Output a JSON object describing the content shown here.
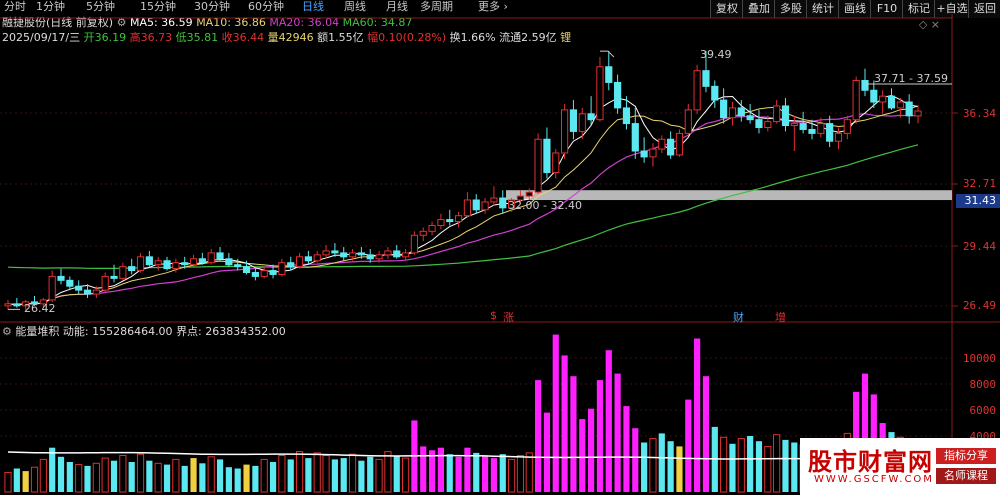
{
  "periods": [
    "分时",
    "1分钟",
    "5分钟",
    "15分钟",
    "30分钟",
    "60分钟",
    "日线",
    "周线",
    "月线",
    "多周期",
    "更多 ›"
  ],
  "active_period": "日线",
  "toolbar": [
    "复权",
    "叠加",
    "多股",
    "统计",
    "画线",
    "F10",
    "标记",
    "+自选",
    "返回"
  ],
  "title_line": {
    "stock": "融捷股份(日线 前复权)",
    "ma5": "MA5: 36.59",
    "ma10": "MA10: 36.86",
    "ma20": "MA20: 36.04",
    "ma60": "MA60: 34.87"
  },
  "quote_line": {
    "date": "2025/09/17/三",
    "open": "开36.19",
    "high": "高36.73",
    "low": "低35.81",
    "close": "收36.44",
    "volume": "量42946",
    "amount": "额1.55亿",
    "change": "幅0.10(0.28%)",
    "turnover": "换1.66%",
    "float": "流通2.59亿",
    "lock": "锂"
  },
  "price_axis": [
    "36.34",
    "32.71",
    "29.44",
    "26.49"
  ],
  "current_price_tag": "31.43",
  "annotations": {
    "high_mark": "39.49",
    "low_mark": "26.42",
    "zone_label": "32.00 - 32.40",
    "range_label": "37.71 - 37.59"
  },
  "events": [
    {
      "text": "$",
      "color": "#e03030"
    },
    {
      "text": "涨",
      "color": "#e03030"
    },
    {
      "text": "财",
      "color": "#4aa3ff"
    },
    {
      "text": "增",
      "color": "#e03030"
    }
  ],
  "indicator": {
    "title": "能量堆积",
    "momentum": "动能: 155286464.00",
    "boundary": "界点: 263834352.00"
  },
  "volume_axis": [
    "10000",
    "8000",
    "6000",
    "4000"
  ],
  "watermark": {
    "title": "股市财富网",
    "url": "WWW.GSCFW.COM",
    "badge1": "指标分享",
    "badge2": "名师课程"
  },
  "colors": {
    "up": "#e03030",
    "down": "#5ce8f0",
    "ma5": "#ffffff",
    "ma10": "#e8d470",
    "ma20": "#d040d0",
    "ma60": "#40c040",
    "vol_mag": "#ff20ff",
    "vol_cyan": "#5ce8f0",
    "vol_yellow": "#f0d040",
    "zone": "#b8b8b8"
  },
  "candles": [
    [
      26.5,
      26.8,
      26.3,
      26.6
    ],
    [
      26.6,
      26.9,
      26.4,
      26.5
    ],
    [
      26.5,
      26.8,
      26.3,
      26.7
    ],
    [
      26.7,
      27.0,
      26.5,
      26.6
    ],
    [
      26.6,
      26.9,
      26.4,
      26.8
    ],
    [
      26.8,
      28.3,
      26.7,
      28.0
    ],
    [
      28.0,
      28.4,
      27.6,
      27.8
    ],
    [
      27.8,
      28.0,
      27.3,
      27.5
    ],
    [
      27.5,
      27.8,
      27.1,
      27.3
    ],
    [
      27.3,
      27.6,
      26.9,
      27.1
    ],
    [
      27.1,
      27.5,
      26.9,
      27.3
    ],
    [
      27.3,
      28.2,
      27.2,
      28.0
    ],
    [
      28.0,
      28.6,
      27.7,
      27.9
    ],
    [
      27.9,
      28.7,
      27.8,
      28.5
    ],
    [
      28.5,
      28.9,
      28.1,
      28.3
    ],
    [
      28.3,
      29.2,
      28.2,
      29.0
    ],
    [
      29.0,
      29.3,
      28.5,
      28.6
    ],
    [
      28.6,
      29.0,
      28.3,
      28.8
    ],
    [
      28.8,
      29.0,
      28.3,
      28.4
    ],
    [
      28.4,
      28.9,
      28.2,
      28.7
    ],
    [
      28.7,
      29.0,
      28.4,
      28.6
    ],
    [
      28.6,
      29.1,
      28.5,
      28.9
    ],
    [
      28.9,
      29.2,
      28.6,
      28.7
    ],
    [
      28.7,
      29.4,
      28.6,
      29.2
    ],
    [
      29.2,
      29.5,
      28.8,
      28.9
    ],
    [
      28.9,
      29.2,
      28.5,
      28.6
    ],
    [
      28.6,
      28.9,
      28.3,
      28.5
    ],
    [
      28.5,
      28.8,
      28.1,
      28.2
    ],
    [
      28.2,
      28.5,
      27.8,
      28.0
    ],
    [
      28.0,
      28.5,
      27.9,
      28.3
    ],
    [
      28.3,
      28.6,
      27.9,
      28.1
    ],
    [
      28.1,
      28.9,
      28.0,
      28.7
    ],
    [
      28.7,
      29.0,
      28.3,
      28.5
    ],
    [
      28.5,
      29.2,
      28.4,
      29.0
    ],
    [
      29.0,
      29.3,
      28.6,
      28.8
    ],
    [
      28.8,
      29.3,
      28.7,
      29.1
    ],
    [
      29.1,
      29.6,
      28.9,
      29.3
    ],
    [
      29.3,
      29.7,
      29.0,
      29.2
    ],
    [
      29.2,
      29.5,
      28.8,
      29.0
    ],
    [
      29.0,
      29.4,
      28.8,
      29.2
    ],
    [
      29.2,
      29.5,
      28.9,
      29.1
    ],
    [
      29.1,
      29.4,
      28.7,
      28.9
    ],
    [
      28.9,
      29.3,
      28.7,
      29.1
    ],
    [
      29.1,
      29.5,
      28.9,
      29.3
    ],
    [
      29.3,
      29.6,
      28.9,
      29.0
    ],
    [
      29.0,
      29.4,
      28.8,
      29.2
    ],
    [
      29.2,
      30.3,
      29.1,
      30.1
    ],
    [
      30.1,
      30.5,
      29.8,
      30.3
    ],
    [
      30.3,
      30.8,
      30.1,
      30.6
    ],
    [
      30.6,
      31.2,
      30.4,
      30.9
    ],
    [
      30.9,
      31.4,
      30.6,
      30.8
    ],
    [
      30.8,
      31.3,
      30.5,
      31.1
    ],
    [
      31.1,
      32.3,
      31.0,
      31.9
    ],
    [
      31.9,
      32.2,
      31.2,
      31.4
    ],
    [
      31.4,
      32.0,
      31.2,
      31.8
    ],
    [
      31.8,
      32.6,
      31.6,
      32.0
    ],
    [
      32.0,
      32.4,
      31.2,
      31.5
    ],
    [
      31.5,
      32.0,
      31.3,
      31.9
    ],
    [
      31.9,
      32.4,
      31.8,
      32.1
    ],
    [
      32.1,
      32.5,
      31.9,
      32.3
    ],
    [
      32.3,
      35.3,
      32.2,
      35.0
    ],
    [
      35.0,
      35.6,
      33.0,
      33.3
    ],
    [
      33.3,
      34.5,
      33.0,
      34.3
    ],
    [
      34.3,
      36.8,
      34.0,
      36.5
    ],
    [
      36.5,
      37.0,
      35.0,
      35.4
    ],
    [
      35.4,
      36.6,
      35.0,
      36.3
    ],
    [
      36.3,
      37.2,
      35.7,
      36.0
    ],
    [
      36.0,
      39.2,
      35.9,
      38.7
    ],
    [
      38.7,
      39.5,
      37.5,
      37.9
    ],
    [
      37.9,
      38.3,
      36.3,
      36.6
    ],
    [
      36.6,
      37.2,
      35.5,
      35.8
    ],
    [
      35.8,
      36.6,
      34.0,
      34.4
    ],
    [
      34.4,
      35.1,
      33.8,
      34.1
    ],
    [
      34.1,
      34.8,
      33.6,
      34.5
    ],
    [
      34.5,
      35.2,
      34.3,
      35.0
    ],
    [
      35.0,
      35.4,
      34.0,
      34.2
    ],
    [
      34.2,
      35.5,
      34.1,
      35.3
    ],
    [
      35.3,
      36.8,
      35.2,
      36.5
    ],
    [
      36.5,
      38.8,
      36.3,
      38.5
    ],
    [
      38.5,
      39.5,
      37.4,
      37.7
    ],
    [
      37.7,
      38.0,
      36.6,
      37.0
    ],
    [
      37.0,
      37.6,
      35.8,
      36.1
    ],
    [
      36.1,
      36.9,
      35.7,
      36.6
    ],
    [
      36.6,
      37.0,
      35.9,
      36.2
    ],
    [
      36.2,
      36.8,
      35.8,
      36.0
    ],
    [
      36.0,
      36.5,
      35.3,
      35.6
    ],
    [
      35.6,
      36.2,
      35.4,
      35.9
    ],
    [
      35.9,
      37.0,
      35.8,
      36.7
    ],
    [
      36.7,
      37.1,
      35.4,
      35.7
    ],
    [
      35.7,
      36.2,
      34.4,
      35.8
    ],
    [
      35.8,
      36.4,
      35.3,
      35.5
    ],
    [
      35.5,
      36.0,
      35.0,
      35.3
    ],
    [
      35.3,
      36.1,
      35.1,
      35.8
    ],
    [
      35.8,
      36.2,
      34.6,
      34.9
    ],
    [
      34.9,
      35.6,
      34.5,
      35.3
    ],
    [
      35.3,
      36.2,
      35.0,
      36.0
    ],
    [
      36.0,
      38.2,
      35.8,
      38.0
    ],
    [
      38.0,
      38.6,
      37.2,
      37.5
    ],
    [
      37.5,
      38.0,
      36.6,
      36.9
    ],
    [
      36.9,
      37.5,
      36.3,
      37.2
    ],
    [
      37.2,
      37.6,
      36.5,
      36.6
    ],
    [
      36.6,
      37.1,
      36.1,
      36.9
    ],
    [
      36.9,
      37.3,
      35.8,
      36.2
    ],
    [
      36.19,
      36.73,
      35.81,
      36.44
    ]
  ],
  "volumes": [
    [
      1200,
      "u"
    ],
    [
      1500,
      "d"
    ],
    [
      1300,
      "y"
    ],
    [
      1600,
      "u"
    ],
    [
      2200,
      "u"
    ],
    [
      3100,
      "d"
    ],
    [
      2400,
      "d"
    ],
    [
      2000,
      "d"
    ],
    [
      1800,
      "u"
    ],
    [
      1700,
      "d"
    ],
    [
      1900,
      "u"
    ],
    [
      2300,
      "u"
    ],
    [
      2100,
      "d"
    ],
    [
      2500,
      "u"
    ],
    [
      2000,
      "d"
    ],
    [
      2600,
      "u"
    ],
    [
      2100,
      "d"
    ],
    [
      1900,
      "u"
    ],
    [
      1800,
      "d"
    ],
    [
      2200,
      "u"
    ],
    [
      1700,
      "d"
    ],
    [
      2300,
      "y"
    ],
    [
      1900,
      "d"
    ],
    [
      2400,
      "u"
    ],
    [
      2200,
      "d"
    ],
    [
      1600,
      "d"
    ],
    [
      1500,
      "d"
    ],
    [
      1800,
      "y"
    ],
    [
      1700,
      "d"
    ],
    [
      2200,
      "u"
    ],
    [
      2000,
      "d"
    ],
    [
      2500,
      "u"
    ],
    [
      2200,
      "d"
    ],
    [
      2800,
      "u"
    ],
    [
      2300,
      "d"
    ],
    [
      2700,
      "u"
    ],
    [
      2500,
      "u"
    ],
    [
      2200,
      "d"
    ],
    [
      2300,
      "d"
    ],
    [
      2600,
      "u"
    ],
    [
      2100,
      "d"
    ],
    [
      2400,
      "d"
    ],
    [
      2200,
      "u"
    ],
    [
      2800,
      "u"
    ],
    [
      2500,
      "d"
    ],
    [
      2300,
      "u"
    ],
    [
      5200,
      "m"
    ],
    [
      3200,
      "m"
    ],
    [
      2900,
      "m"
    ],
    [
      3100,
      "m"
    ],
    [
      2600,
      "d"
    ],
    [
      2400,
      "m"
    ],
    [
      3100,
      "m"
    ],
    [
      2700,
      "d"
    ],
    [
      2500,
      "m"
    ],
    [
      2300,
      "m"
    ],
    [
      2600,
      "d"
    ],
    [
      2200,
      "u"
    ],
    [
      2500,
      "u"
    ],
    [
      2700,
      "u"
    ],
    [
      8300,
      "m"
    ],
    [
      5800,
      "m"
    ],
    [
      11800,
      "m"
    ],
    [
      10200,
      "m"
    ],
    [
      8600,
      "m"
    ],
    [
      5300,
      "m"
    ],
    [
      6100,
      "m"
    ],
    [
      8300,
      "m"
    ],
    [
      10600,
      "m"
    ],
    [
      8800,
      "m"
    ],
    [
      6300,
      "m"
    ],
    [
      4600,
      "m"
    ],
    [
      3500,
      "d"
    ],
    [
      3800,
      "u"
    ],
    [
      4200,
      "d"
    ],
    [
      3600,
      "d"
    ],
    [
      3200,
      "y"
    ],
    [
      6800,
      "m"
    ],
    [
      11500,
      "m"
    ],
    [
      8600,
      "m"
    ],
    [
      4700,
      "d"
    ],
    [
      3900,
      "u"
    ],
    [
      3400,
      "d"
    ],
    [
      3800,
      "u"
    ],
    [
      4000,
      "d"
    ],
    [
      3600,
      "d"
    ],
    [
      3200,
      "u"
    ],
    [
      4100,
      "u"
    ],
    [
      3700,
      "d"
    ],
    [
      3500,
      "d"
    ],
    [
      3300,
      "u"
    ],
    [
      3400,
      "d"
    ],
    [
      3600,
      "u"
    ],
    [
      3200,
      "d"
    ],
    [
      3400,
      "d"
    ],
    [
      4200,
      "u"
    ],
    [
      7400,
      "m"
    ],
    [
      8800,
      "m"
    ],
    [
      7200,
      "m"
    ],
    [
      5000,
      "m"
    ],
    [
      4300,
      "d"
    ],
    [
      3900,
      "u"
    ],
    [
      3500,
      "d"
    ],
    [
      3200,
      "u"
    ]
  ]
}
